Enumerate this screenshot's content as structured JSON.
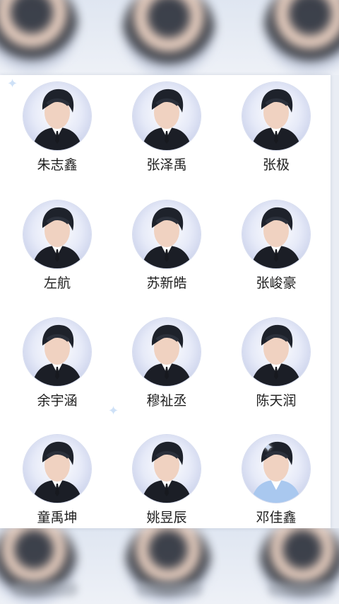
{
  "members": [
    {
      "name": "朱志鑫"
    },
    {
      "name": "张泽禹"
    },
    {
      "name": "张极"
    },
    {
      "name": "左航"
    },
    {
      "name": "苏新皓"
    },
    {
      "name": "张峻豪"
    },
    {
      "name": "余宇涵"
    },
    {
      "name": "穆祉丞"
    },
    {
      "name": "陈天润"
    },
    {
      "name": "童禹坤"
    },
    {
      "name": "姚昱辰"
    },
    {
      "name": "邓佳鑫"
    }
  ],
  "colors": {
    "background": "#e9edf4",
    "panel": "#ffffff",
    "name_text": "#1f1f1f",
    "avatar_bg": "#dce2f4",
    "hair": "#1e222b",
    "suit": "#1b1e26",
    "shirt": "#ffffff",
    "skin": "#f0d2c1",
    "sparkle": "#c9def7"
  },
  "icons": {
    "sparkle": "four-point-star-icon",
    "avatar": "portrait-icon"
  }
}
